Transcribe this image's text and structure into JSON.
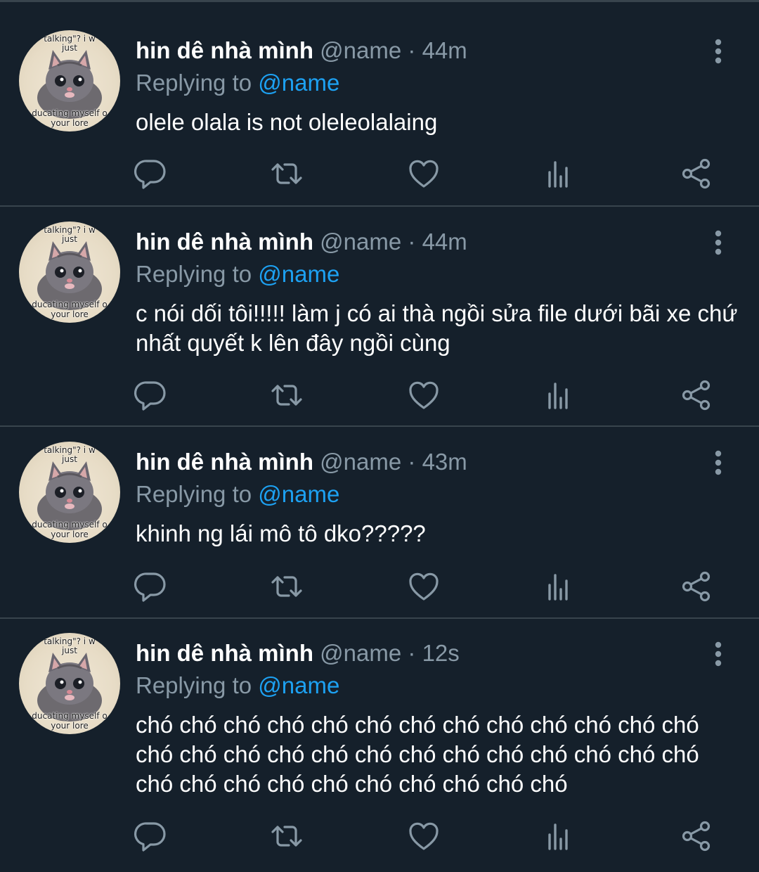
{
  "tweets": [
    {
      "display_name": "hin dê nhà mình",
      "handle": "@name",
      "separator": "·",
      "time": "44m",
      "replying_prefix": "Replying to ",
      "replying_to": "@name",
      "text": "olele olala is not oleleolalaing"
    },
    {
      "display_name": "hin dê nhà mình",
      "handle": "@name",
      "separator": "·",
      "time": "44m",
      "replying_prefix": "Replying to ",
      "replying_to": "@name",
      "text": "c nói dối tôi!!!!! làm j có ai thà ngồi sửa file dưới bãi xe chứ nhất quyết k lên đây ngồi cùng"
    },
    {
      "display_name": "hin dê nhà mình",
      "handle": "@name",
      "separator": "·",
      "time": "43m",
      "replying_prefix": "Replying to ",
      "replying_to": "@name",
      "text": "khinh ng lái mô tô dko?????"
    },
    {
      "display_name": "hin dê nhà mình",
      "handle": "@name",
      "separator": "·",
      "time": "12s",
      "replying_prefix": "Replying to ",
      "replying_to": "@name",
      "text": "chó chó chó chó chó chó chó chó chó chó chó chó chó chó chó chó chó chó chó chó chó chó chó chó chó chó chó chó chó chó chó chó chó chó chó chó"
    }
  ],
  "avatar_caption": {
    "top_line1": "talking\"? i w",
    "top_line2": "just",
    "bottom_line1": "ducating myself o",
    "bottom_line2": "your lore"
  },
  "icons": {
    "reply": "reply-icon",
    "retweet": "retweet-icon",
    "like": "heart-icon",
    "analytics": "analytics-icon",
    "share": "share-icon",
    "more": "more-vertical-icon"
  },
  "colors": {
    "background": "#15202b",
    "divider": "#38444d",
    "secondary_text": "#8899a6",
    "mention": "#1da1f2",
    "primary_text": "#ffffff"
  }
}
